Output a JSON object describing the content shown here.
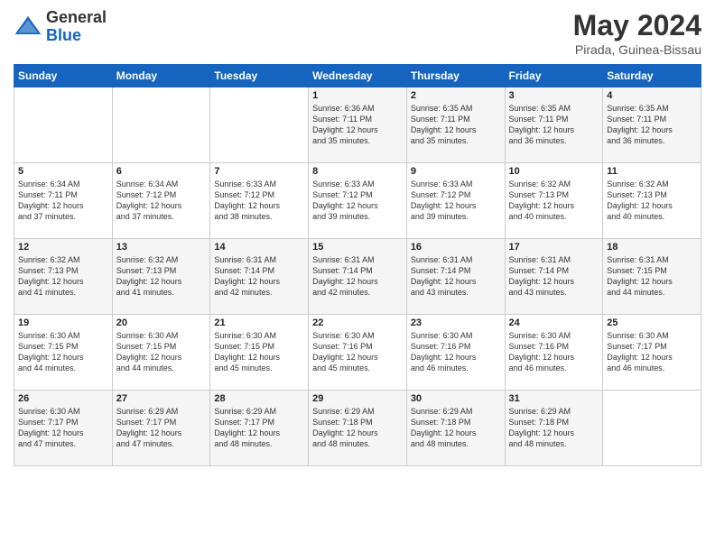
{
  "header": {
    "logo_general": "General",
    "logo_blue": "Blue",
    "month_title": "May 2024",
    "subtitle": "Pirada, Guinea-Bissau"
  },
  "days_of_week": [
    "Sunday",
    "Monday",
    "Tuesday",
    "Wednesday",
    "Thursday",
    "Friday",
    "Saturday"
  ],
  "weeks": [
    [
      {
        "day": "",
        "info": ""
      },
      {
        "day": "",
        "info": ""
      },
      {
        "day": "",
        "info": ""
      },
      {
        "day": "1",
        "info": "Sunrise: 6:36 AM\nSunset: 7:11 PM\nDaylight: 12 hours\nand 35 minutes."
      },
      {
        "day": "2",
        "info": "Sunrise: 6:35 AM\nSunset: 7:11 PM\nDaylight: 12 hours\nand 35 minutes."
      },
      {
        "day": "3",
        "info": "Sunrise: 6:35 AM\nSunset: 7:11 PM\nDaylight: 12 hours\nand 36 minutes."
      },
      {
        "day": "4",
        "info": "Sunrise: 6:35 AM\nSunset: 7:11 PM\nDaylight: 12 hours\nand 36 minutes."
      }
    ],
    [
      {
        "day": "5",
        "info": "Sunrise: 6:34 AM\nSunset: 7:11 PM\nDaylight: 12 hours\nand 37 minutes."
      },
      {
        "day": "6",
        "info": "Sunrise: 6:34 AM\nSunset: 7:12 PM\nDaylight: 12 hours\nand 37 minutes."
      },
      {
        "day": "7",
        "info": "Sunrise: 6:33 AM\nSunset: 7:12 PM\nDaylight: 12 hours\nand 38 minutes."
      },
      {
        "day": "8",
        "info": "Sunrise: 6:33 AM\nSunset: 7:12 PM\nDaylight: 12 hours\nand 39 minutes."
      },
      {
        "day": "9",
        "info": "Sunrise: 6:33 AM\nSunset: 7:12 PM\nDaylight: 12 hours\nand 39 minutes."
      },
      {
        "day": "10",
        "info": "Sunrise: 6:32 AM\nSunset: 7:13 PM\nDaylight: 12 hours\nand 40 minutes."
      },
      {
        "day": "11",
        "info": "Sunrise: 6:32 AM\nSunset: 7:13 PM\nDaylight: 12 hours\nand 40 minutes."
      }
    ],
    [
      {
        "day": "12",
        "info": "Sunrise: 6:32 AM\nSunset: 7:13 PM\nDaylight: 12 hours\nand 41 minutes."
      },
      {
        "day": "13",
        "info": "Sunrise: 6:32 AM\nSunset: 7:13 PM\nDaylight: 12 hours\nand 41 minutes."
      },
      {
        "day": "14",
        "info": "Sunrise: 6:31 AM\nSunset: 7:14 PM\nDaylight: 12 hours\nand 42 minutes."
      },
      {
        "day": "15",
        "info": "Sunrise: 6:31 AM\nSunset: 7:14 PM\nDaylight: 12 hours\nand 42 minutes."
      },
      {
        "day": "16",
        "info": "Sunrise: 6:31 AM\nSunset: 7:14 PM\nDaylight: 12 hours\nand 43 minutes."
      },
      {
        "day": "17",
        "info": "Sunrise: 6:31 AM\nSunset: 7:14 PM\nDaylight: 12 hours\nand 43 minutes."
      },
      {
        "day": "18",
        "info": "Sunrise: 6:31 AM\nSunset: 7:15 PM\nDaylight: 12 hours\nand 44 minutes."
      }
    ],
    [
      {
        "day": "19",
        "info": "Sunrise: 6:30 AM\nSunset: 7:15 PM\nDaylight: 12 hours\nand 44 minutes."
      },
      {
        "day": "20",
        "info": "Sunrise: 6:30 AM\nSunset: 7:15 PM\nDaylight: 12 hours\nand 44 minutes."
      },
      {
        "day": "21",
        "info": "Sunrise: 6:30 AM\nSunset: 7:15 PM\nDaylight: 12 hours\nand 45 minutes."
      },
      {
        "day": "22",
        "info": "Sunrise: 6:30 AM\nSunset: 7:16 PM\nDaylight: 12 hours\nand 45 minutes."
      },
      {
        "day": "23",
        "info": "Sunrise: 6:30 AM\nSunset: 7:16 PM\nDaylight: 12 hours\nand 46 minutes."
      },
      {
        "day": "24",
        "info": "Sunrise: 6:30 AM\nSunset: 7:16 PM\nDaylight: 12 hours\nand 46 minutes."
      },
      {
        "day": "25",
        "info": "Sunrise: 6:30 AM\nSunset: 7:17 PM\nDaylight: 12 hours\nand 46 minutes."
      }
    ],
    [
      {
        "day": "26",
        "info": "Sunrise: 6:30 AM\nSunset: 7:17 PM\nDaylight: 12 hours\nand 47 minutes."
      },
      {
        "day": "27",
        "info": "Sunrise: 6:29 AM\nSunset: 7:17 PM\nDaylight: 12 hours\nand 47 minutes."
      },
      {
        "day": "28",
        "info": "Sunrise: 6:29 AM\nSunset: 7:17 PM\nDaylight: 12 hours\nand 48 minutes."
      },
      {
        "day": "29",
        "info": "Sunrise: 6:29 AM\nSunset: 7:18 PM\nDaylight: 12 hours\nand 48 minutes."
      },
      {
        "day": "30",
        "info": "Sunrise: 6:29 AM\nSunset: 7:18 PM\nDaylight: 12 hours\nand 48 minutes."
      },
      {
        "day": "31",
        "info": "Sunrise: 6:29 AM\nSunset: 7:18 PM\nDaylight: 12 hours\nand 48 minutes."
      },
      {
        "day": "",
        "info": ""
      }
    ]
  ]
}
